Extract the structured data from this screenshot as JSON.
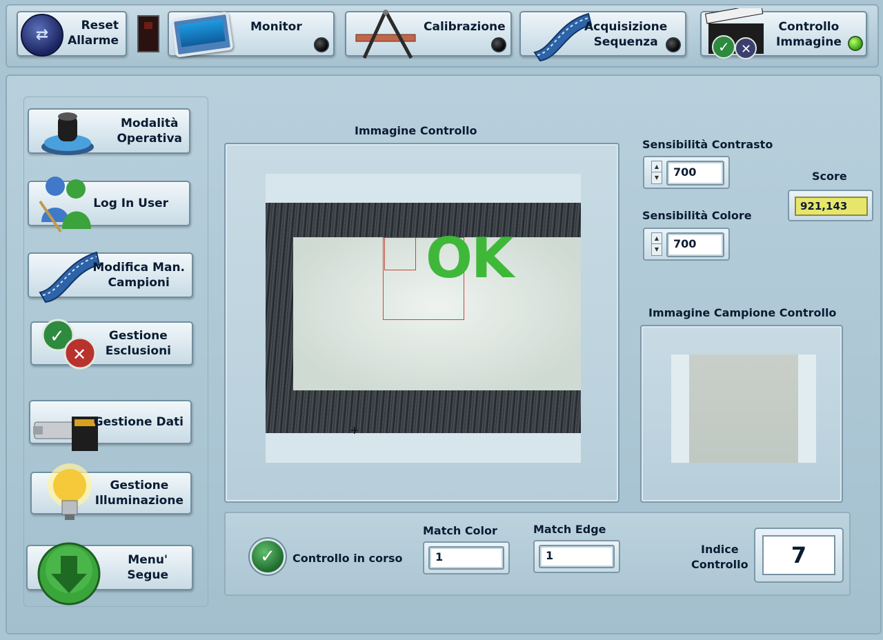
{
  "toolbar": {
    "reset_label": "Reset\nAllarme",
    "monitor_label": "Monitor",
    "calibrazione_label": "Calibrazione",
    "acquisizione_label": "Acquisizione\nSequenza",
    "controllo_label": "Controllo\nImmagine"
  },
  "sidebar": {
    "items": [
      {
        "label": "Modalità\nOperativa"
      },
      {
        "label": "Log In User"
      },
      {
        "label": "Modifica Man.\nCampioni"
      },
      {
        "label": "Gestione\nEsclusioni"
      },
      {
        "label": "Gestione Dati"
      },
      {
        "label": "Gestione\nIlluminazione"
      },
      {
        "label": "Menu'\nSegue"
      }
    ]
  },
  "main": {
    "image_title": "Immagine Controllo",
    "overlay_text": "OK",
    "sens_contrasto_label": "Sensibilità Contrasto",
    "sens_contrasto_value": "700",
    "sens_colore_label": "Sensibilità Colore",
    "sens_colore_value": "700",
    "score_label": "Score",
    "score_value": "921,143",
    "sample_title": "Immagine Campione Controllo",
    "controllo_in_corso": "Controllo in corso",
    "match_color_label": "Match Color",
    "match_color_value": "1",
    "match_edge_label": "Match Edge",
    "match_edge_value": "1",
    "indice_label": "Indice\nControllo",
    "indice_value": "7"
  },
  "colors": {
    "background": "#a9c4d2",
    "ok_green": "#3fb83a",
    "score_yellow": "#e8e66a"
  }
}
